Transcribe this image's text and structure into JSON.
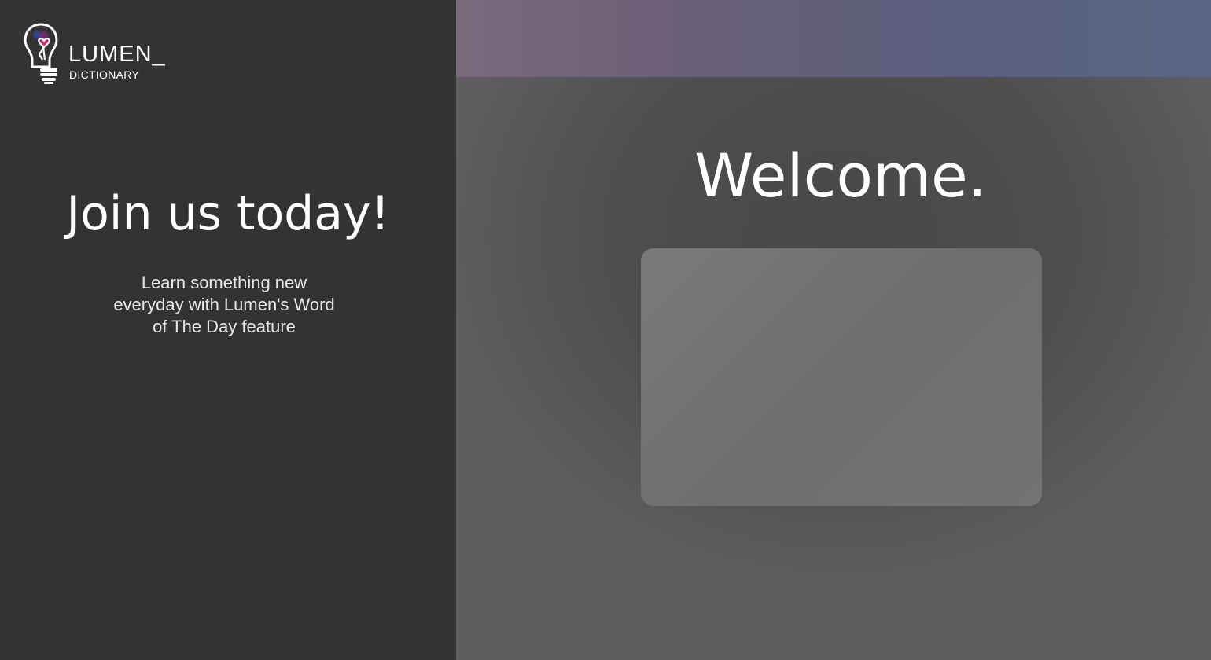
{
  "brand": {
    "name": "LUMEN_",
    "subtitle": "DICTIONARY",
    "logo_icon": "lightbulb-heart-icon"
  },
  "promo": {
    "heading": "Join us today!",
    "body": "Learn something new everyday with Lumen's Word of The Day feature"
  },
  "auth": {
    "heading": "Welcome."
  },
  "colors": {
    "left_panel": "#333333",
    "right_panel": "#4e4e4e",
    "band_start": "#7a6a7c",
    "band_end": "#586585",
    "card": "#737373",
    "logo_accent_pink": "#c2337a",
    "logo_accent_blue": "#2c4a9e"
  }
}
